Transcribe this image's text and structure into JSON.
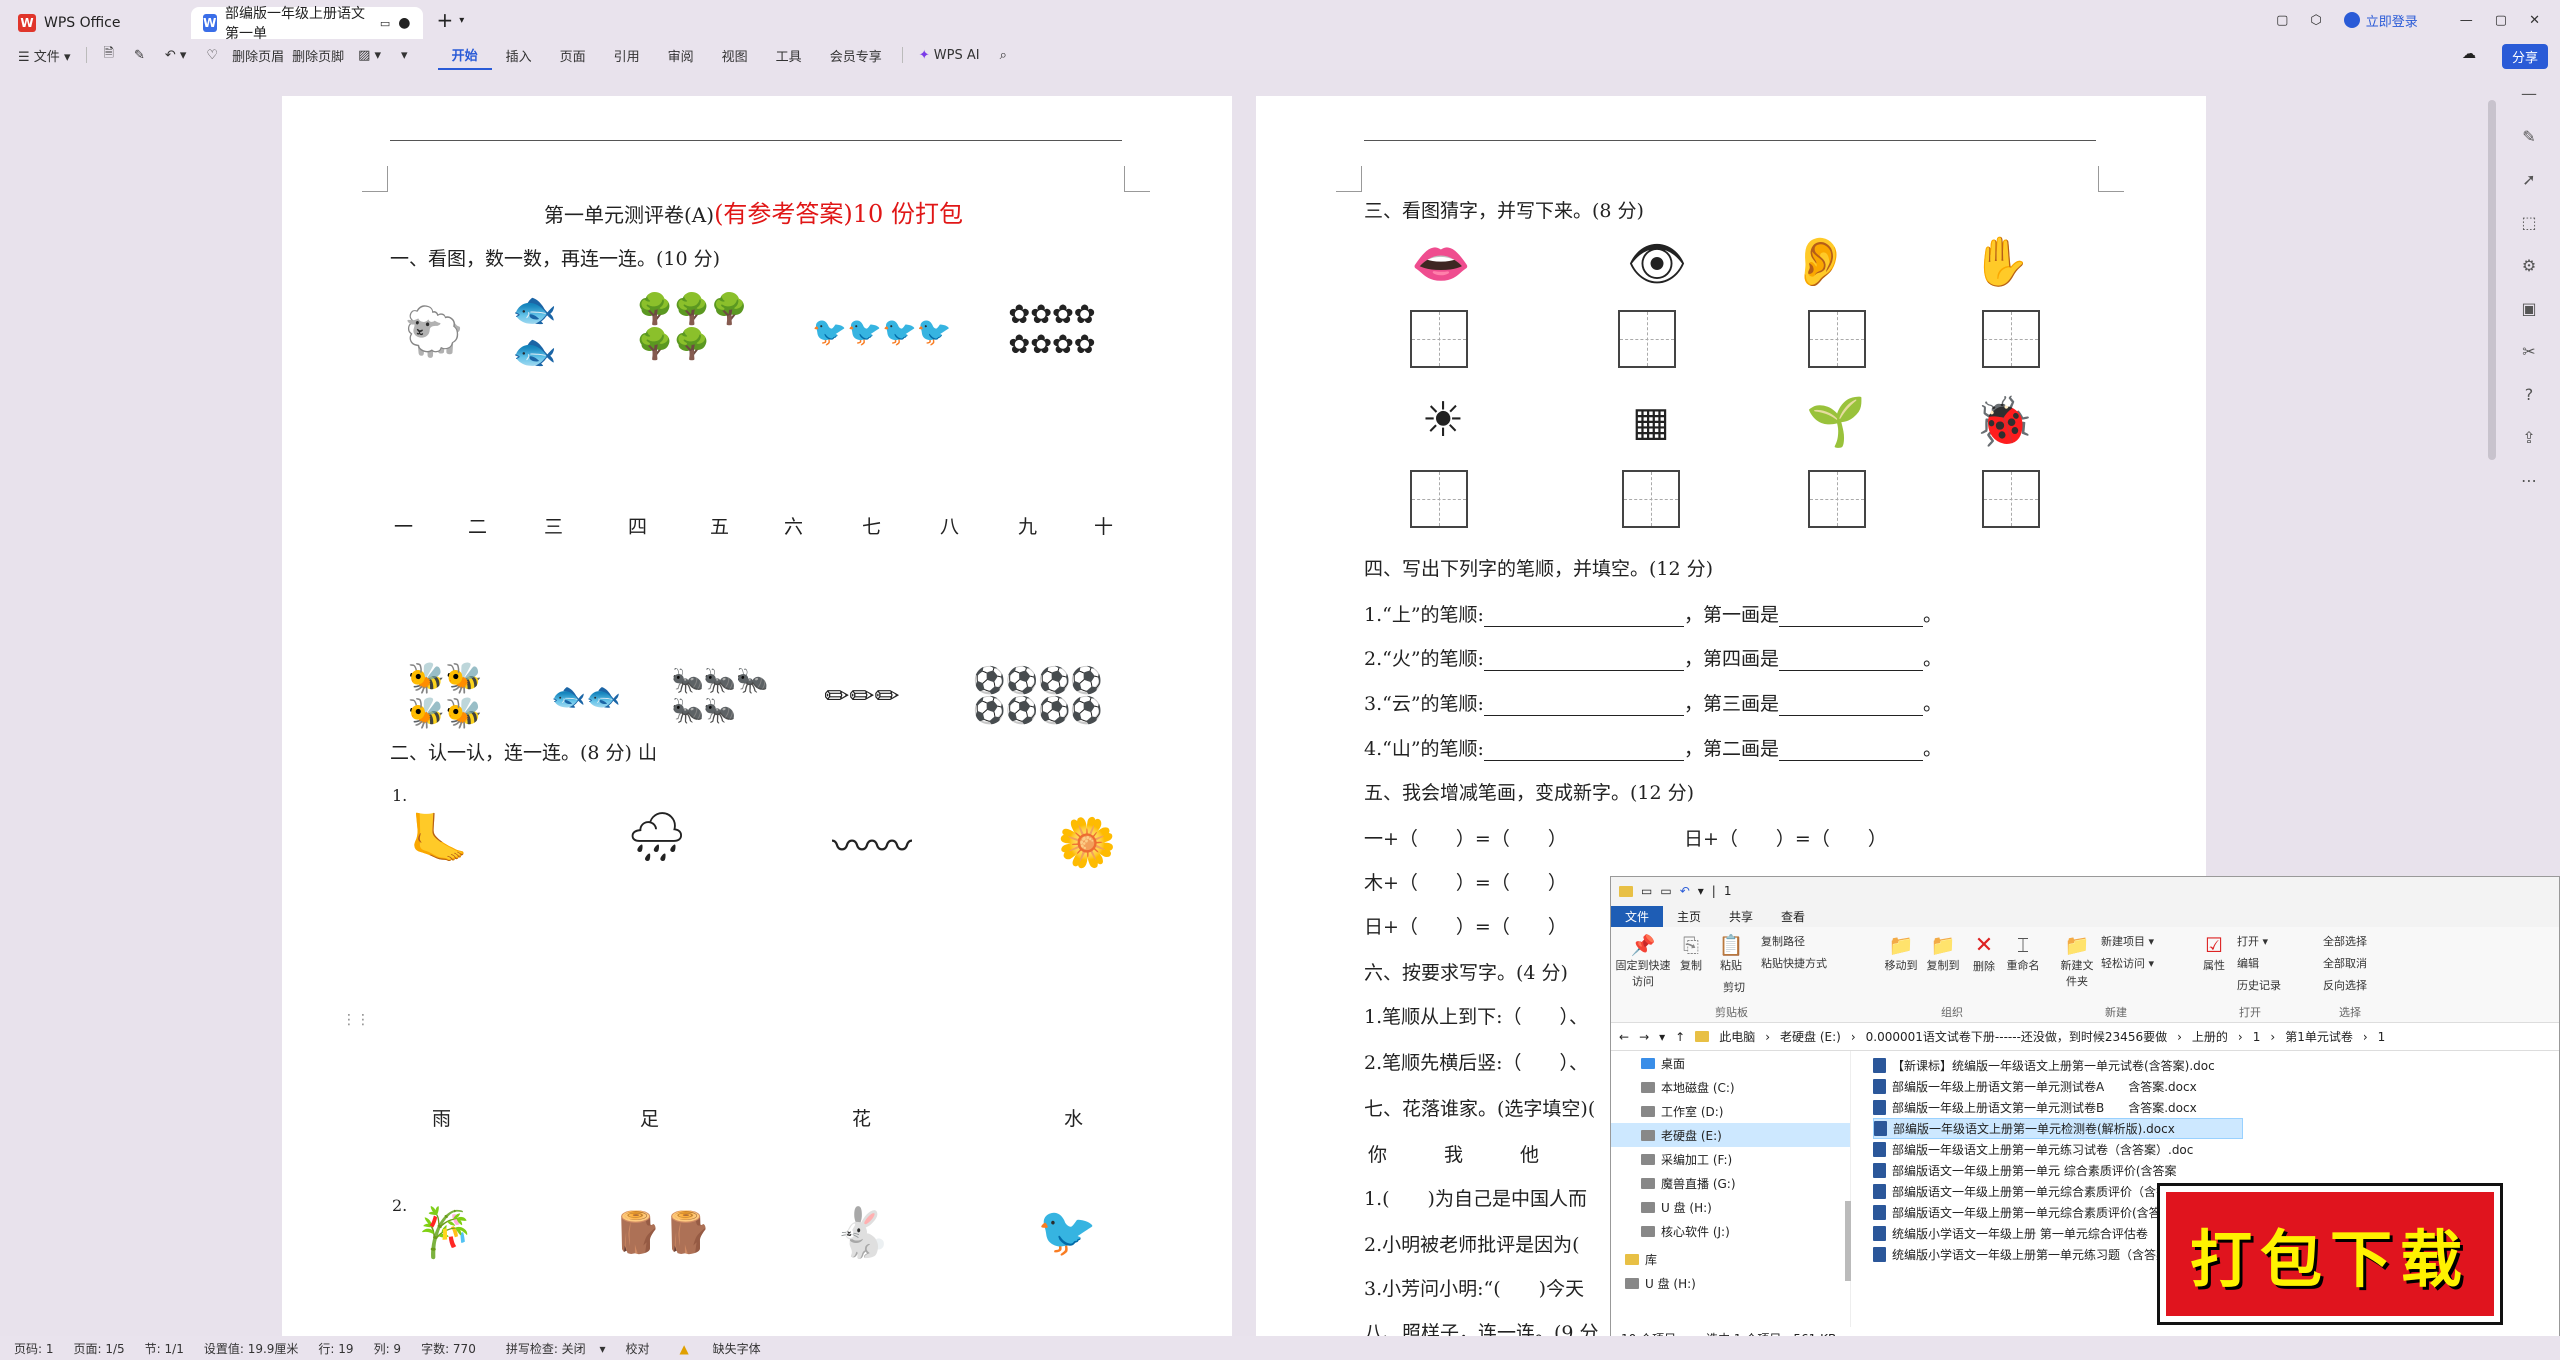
{
  "titlebar": {
    "app_tab": "WPS Office",
    "doc_tab": "部编版一年级上册语文第一单",
    "login": "立即登录"
  },
  "toolbar": {
    "file": "文件",
    "delete_header": "删除页眉",
    "delete_footer": "删除页脚",
    "tabs": [
      "开始",
      "插入",
      "页面",
      "引用",
      "审阅",
      "视图",
      "工具",
      "会员专享"
    ],
    "wps_ai": "WPS AI",
    "share": "分享"
  },
  "left_page": {
    "title_black": "第一单元测评卷(A)",
    "title_red": "(有参考答案)10 份打包",
    "q1": "一、看图，数一数，再连一连。(10 分)",
    "numbers": [
      "一",
      "二",
      "三",
      "四",
      "五",
      "六",
      "七",
      "八",
      "九",
      "十"
    ],
    "q2": "二、认一认，连一连。(8 分) 山",
    "row1_label": "1.",
    "row1_words": [
      "雨",
      "足",
      "花",
      "水"
    ],
    "row2_label": "2.",
    "row2_words": [
      "木",
      "鸟",
      "竹",
      "兔"
    ]
  },
  "right_page": {
    "q3": "三、看图猜字，并写下来。(8 分)",
    "q4": "四、写出下列字的笔顺，并填空。(12 分)",
    "q4_items": [
      {
        "a": "1.“上”的笔顺:",
        "b": "，第一画是"
      },
      {
        "a": "2.“火”的笔顺:",
        "b": "，第四画是"
      },
      {
        "a": "3.“云”的笔顺:",
        "b": "，第三画是"
      },
      {
        "a": "4.“山”的笔顺:",
        "b": "，第二画是"
      }
    ],
    "q5": "五、我会增减笔画，变成新字。(12 分)",
    "q5_rows": [
      "一+（　　）=（　　）",
      "日+（　　）=（　　）",
      "木+（　　）=（　　）",
      "日+（　　）=（　　）"
    ],
    "q6": "六、按要求写字。(4 分)",
    "q6_items": [
      "1.笔顺从上到下:（　　）、",
      "2.笔顺先横后竖:（　　）、"
    ],
    "q7": "七、花落谁家。(选字填空)(",
    "q7_words": "你　　　我　　　他",
    "q7_items": [
      "1.(　　)为自己是中国人而",
      "2.小明被老师批评是因为(",
      "3.小芳问小明:“(　　)今天"
    ],
    "q8": "八、照样子，连一连。(9 分"
  },
  "explorer": {
    "title": "1",
    "tabs": [
      "文件",
      "主页",
      "共享",
      "查看"
    ],
    "groups": [
      "剪贴板",
      "组织",
      "新建",
      "打开",
      "选择"
    ],
    "ribbon_items": [
      "固定到快速访问",
      "复制",
      "粘贴",
      "复制路径",
      "粘贴快捷方式",
      "剪切",
      "移动到",
      "复制到",
      "删除",
      "重命名",
      "新建文件夹",
      "新建项目",
      "轻松访问",
      "属性",
      "打开",
      "编辑",
      "历史记录",
      "全部选择",
      "全部取消",
      "反向选择"
    ],
    "path": [
      "此电脑",
      "老硬盘 (E:)",
      "0.000001语文试卷下册------还没做，到时候23456要做",
      "上册的",
      "1",
      "第1单元试卷",
      "1"
    ],
    "tree": [
      "桌面",
      "本地磁盘 (C:)",
      "工作室 (D:)",
      "老硬盘 (E:)",
      "采编加工 (F:)",
      "魔兽直播 (G:)",
      "U 盘 (H:)",
      "核心软件 (J:)",
      "库",
      "U 盘 (H:)"
    ],
    "files": [
      "【新课标】统编版一年级语文上册第一单元试卷(含答案).doc",
      "部编版一年级上册语文第一单元测试卷A　　含答案.docx",
      "部编版一年级上册语文第一单元测试卷B　　含答案.docx",
      "部编版一年级语文上册第一单元检测卷(解析版).docx",
      "部编版一年级语文上册第一单元练习试卷（含答案）.doc",
      "部编版语文一年级上册第一单元 综合素质评价(含答案",
      "部编版语文一年级上册第一单元综合素质评价（含答",
      "部编版语文一年级上册第一单元综合素质评价(含答",
      "统编版小学语文一年级上册 第一单元综合评估卷",
      "统编版小学语文一年级上册第一单元练习题（含答案"
    ],
    "status_count": "10 个项目",
    "status_sel": "选中 1 个项目　561 KB"
  },
  "banner": "打包下载",
  "statusbar": [
    "页码: 1",
    "页面: 1/5",
    "节: 1/1",
    "设置值: 19.9厘米",
    "行: 19",
    "列: 9",
    "字数: 770",
    "拼写检查: 关闭",
    "校对",
    "缺失字体"
  ]
}
